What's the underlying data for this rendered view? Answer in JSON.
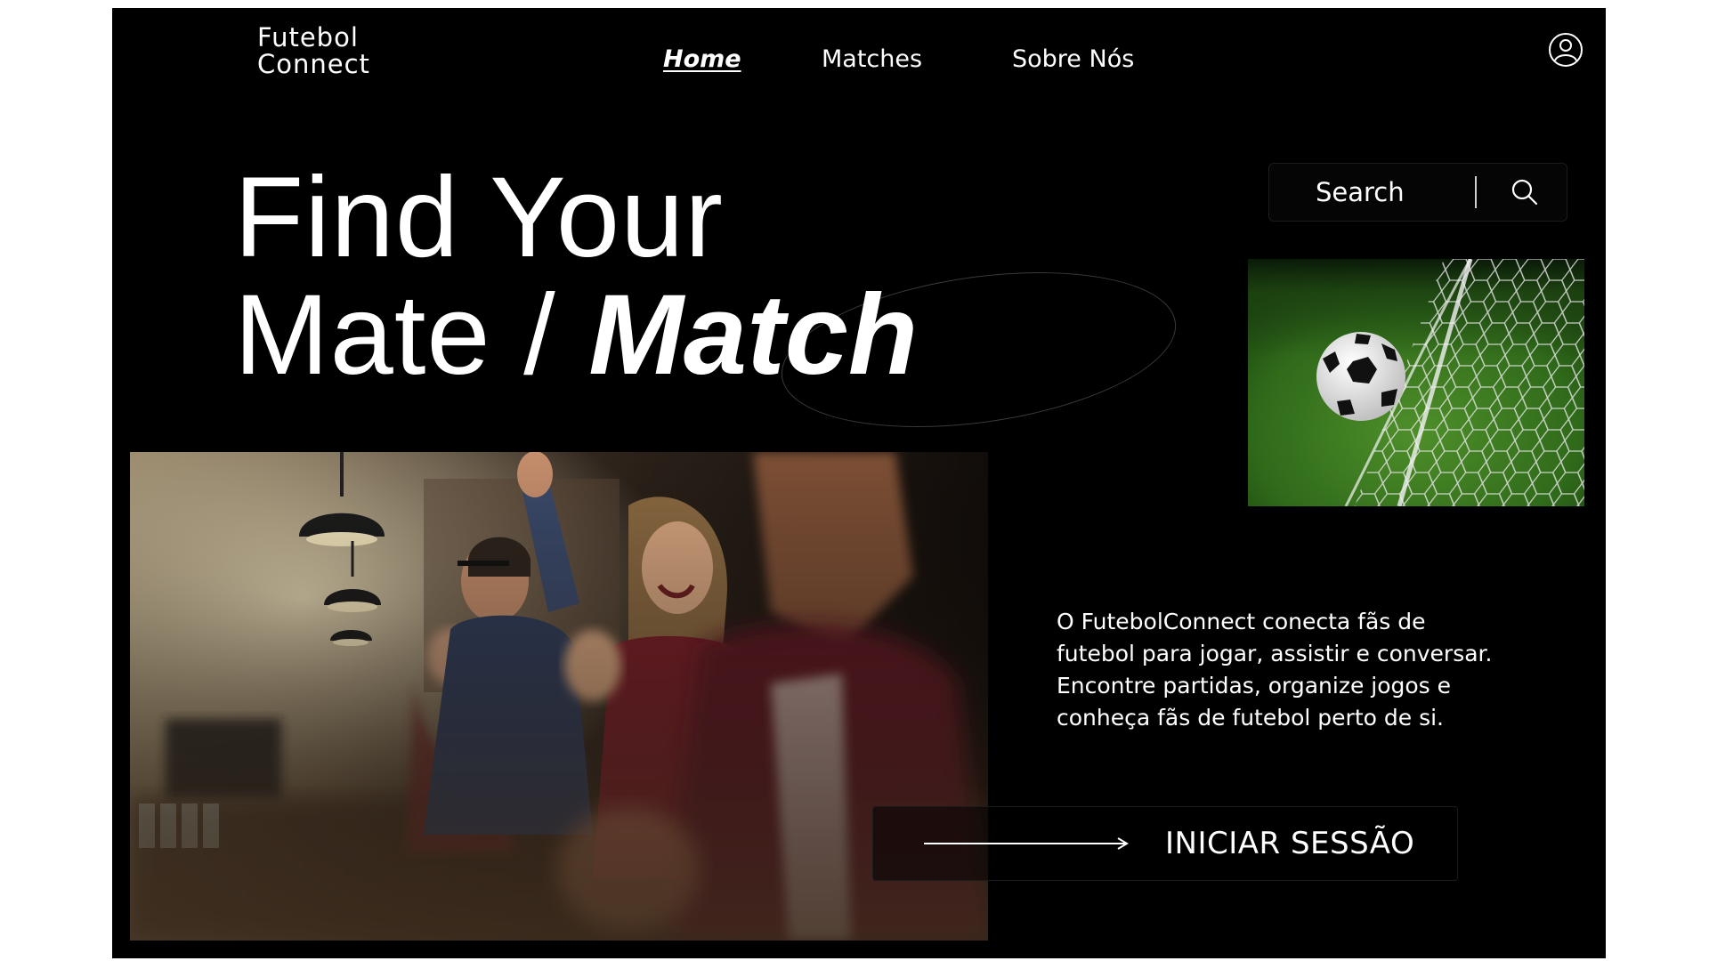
{
  "logo": {
    "line1": "Futebol",
    "line2": "Connect"
  },
  "nav": {
    "items": [
      {
        "label": "Home",
        "active": true
      },
      {
        "label": "Matches",
        "active": false
      },
      {
        "label": "Sobre Nós",
        "active": false
      }
    ]
  },
  "header": {
    "user_icon": "user-circle-icon"
  },
  "hero": {
    "line1": "Find Your",
    "line2_plain": "Mate /",
    "line2_emphasis": "Match"
  },
  "search": {
    "placeholder": "Search",
    "icon": "search-icon"
  },
  "images": {
    "ball": "soccer-ball-in-net-photo",
    "fans": "cheering-fans-in-bar-photo"
  },
  "description": {
    "line1": "O FutebolConnect conecta fãs de",
    "line2": "futebol para jogar, assistir e conversar.",
    "line3": "Encontre partidas, organize jogos e",
    "line4": "conheça fãs de futebol perto de si."
  },
  "cta": {
    "label": "INICIAR SESSÃO",
    "icon": "arrow-right-icon"
  },
  "colors": {
    "background": "#000000",
    "text": "#ffffff",
    "page": "#ffffff"
  }
}
